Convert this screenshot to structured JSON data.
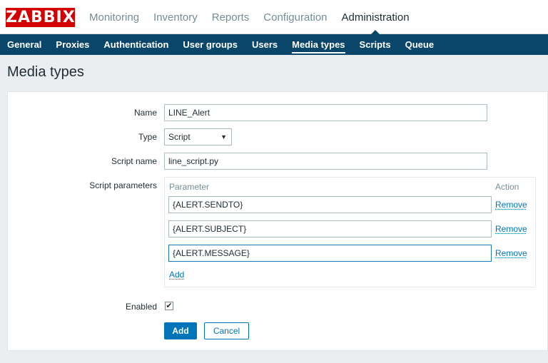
{
  "header": {
    "logo": "ZABBIX",
    "menu": [
      "Monitoring",
      "Inventory",
      "Reports",
      "Configuration",
      "Administration"
    ],
    "active_menu": "Administration"
  },
  "subnav": {
    "items": [
      "General",
      "Proxies",
      "Authentication",
      "User groups",
      "Users",
      "Media types",
      "Scripts",
      "Queue"
    ],
    "active": "Media types"
  },
  "page": {
    "title": "Media types"
  },
  "form": {
    "name_label": "Name",
    "name_value": "LINE_Alert",
    "type_label": "Type",
    "type_value": "Script",
    "script_name_label": "Script name",
    "script_name_value": "line_script.py",
    "params_label": "Script parameters",
    "params_col_parameter": "Parameter",
    "params_col_action": "Action",
    "params": [
      "{ALERT.SENDTO}",
      "{ALERT.SUBJECT}",
      "{ALERT.MESSAGE}"
    ],
    "remove_label": "Remove",
    "add_link": "Add",
    "enabled_label": "Enabled",
    "enabled_checked": true,
    "submit_label": "Add",
    "cancel_label": "Cancel"
  },
  "colors": {
    "brand": "#d40000",
    "nav_bg": "#0a466a",
    "accent": "#0275b8"
  }
}
